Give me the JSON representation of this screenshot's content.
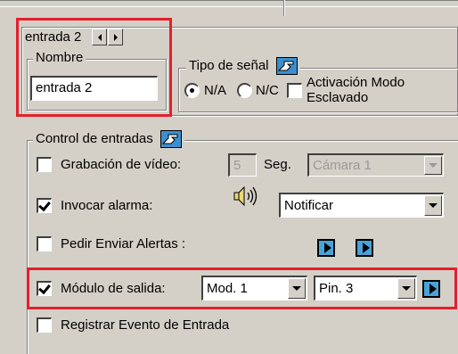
{
  "input_nav": {
    "title": "entrada 2"
  },
  "nombre": {
    "legend": "Nombre",
    "value": "entrada 2"
  },
  "tipo_senal": {
    "legend": "Tipo de señal",
    "options": [
      {
        "label": "N/A",
        "selected": true
      },
      {
        "label": "N/C",
        "selected": false
      }
    ],
    "slave_label_line1": "Activación Modo",
    "slave_label_line2": "Esclavado",
    "slave_checked": false
  },
  "control": {
    "legend": "Control de entradas",
    "video": {
      "label": "Grabación de vídeo:",
      "checked": false,
      "seconds": "5",
      "unit": "Seg.",
      "camera": "Cámara 1"
    },
    "alarm": {
      "label": "Invocar alarma:",
      "checked": true,
      "action": "Notificar"
    },
    "alerts": {
      "label": "Pedir Enviar Alertas :",
      "checked": false
    },
    "output": {
      "label": "Módulo de salida:",
      "checked": true,
      "module": "Mod. 1",
      "pin": "Pin. 3"
    },
    "event": {
      "label": "Registrar Evento de Entrada",
      "checked": false
    }
  },
  "icons": {
    "hand": "pointing-hand-icon",
    "speaker": "speaker-icon",
    "play": "play-arrow-icon"
  },
  "colors": {
    "highlight": "#e3202b",
    "face": "#d4d0c8",
    "play": "#4aa3d8"
  }
}
